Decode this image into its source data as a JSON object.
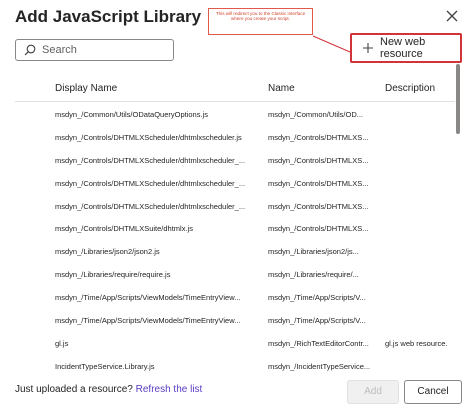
{
  "dialog": {
    "title": "Add JavaScript Library",
    "close_icon": "close-icon"
  },
  "annotation": {
    "text": "This will redirect you to the Classic interface where you create your script.",
    "color": "#d13438"
  },
  "search": {
    "placeholder": "Search",
    "value": ""
  },
  "toolbar": {
    "new_resource_label": "New web resource"
  },
  "table": {
    "headers": [
      "Display Name",
      "Name",
      "Description"
    ],
    "rows": [
      {
        "display": "msdyn_/Common/Utils/ODataQueryOptions.js",
        "name": "msdyn_/Common/Utils/OD...",
        "description": ""
      },
      {
        "display": "msdyn_/Controls/DHTMLXScheduler/dhtmlxscheduler.js",
        "name": "msdyn_/Controls/DHTMLXS...",
        "description": ""
      },
      {
        "display": "msdyn_/Controls/DHTMLXScheduler/dhtmlxscheduler_...",
        "name": "msdyn_/Controls/DHTMLXS...",
        "description": ""
      },
      {
        "display": "msdyn_/Controls/DHTMLXScheduler/dhtmlxscheduler_...",
        "name": "msdyn_/Controls/DHTMLXS...",
        "description": ""
      },
      {
        "display": "msdyn_/Controls/DHTMLXScheduler/dhtmlxscheduler_...",
        "name": "msdyn_/Controls/DHTMLXS...",
        "description": ""
      },
      {
        "display": "msdyn_/Controls/DHTMLXSuite/dhtmlx.js",
        "name": "msdyn_/Controls/DHTMLXS...",
        "description": ""
      },
      {
        "display": "msdyn_/Libraries/json2/json2.js",
        "name": "msdyn_/Libraries/json2/js...",
        "description": ""
      },
      {
        "display": "msdyn_/Libraries/require/require.js",
        "name": "msdyn_/Libraries/require/...",
        "description": ""
      },
      {
        "display": "msdyn_/Time/App/Scripts/ViewModels/TimeEntryView...",
        "name": "msdyn_/Time/App/Scripts/V...",
        "description": ""
      },
      {
        "display": "msdyn_/Time/App/Scripts/ViewModels/TimeEntryView...",
        "name": "msdyn_/Time/App/Scripts/V...",
        "description": ""
      },
      {
        "display": "gl.js",
        "name": "msdyn_/RichTextEditorContr...",
        "description": "gl.js web resource."
      },
      {
        "display": "IncidentTypeService.Library.js",
        "name": "msdyn_/IncidentTypeService...",
        "description": ""
      }
    ]
  },
  "footer": {
    "prompt": "Just uploaded a resource?",
    "refresh_link": "Refresh the list",
    "add_label": "Add",
    "cancel_label": "Cancel"
  }
}
